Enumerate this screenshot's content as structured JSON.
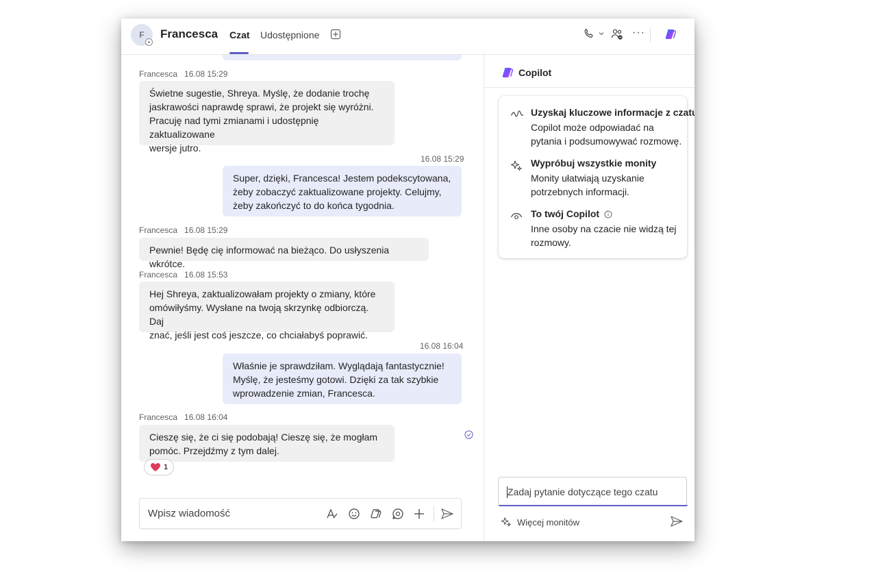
{
  "header": {
    "avatar_initial": "F",
    "contact_name": "Francesca",
    "tabs": [
      {
        "label": "Czat",
        "active": true
      },
      {
        "label": "Udostępnione",
        "active": false
      }
    ],
    "icons": [
      "call-icon",
      "chevron-down-icon",
      "people-icon",
      "more-icon",
      "copilot-icon"
    ]
  },
  "messages": [
    {
      "direction": "in",
      "sender": "Francesca",
      "time": "16.08 15:29",
      "lines": [
        "Świetne sugestie, Shreya. Myślę, że dodanie trochę",
        "jaskrawości naprawdę sprawi, że projekt się wyróżni.",
        "Pracuję nad tymi zmianami i udostępnię zaktualizowane",
        "wersje jutro."
      ]
    },
    {
      "direction": "out",
      "time": "16.08 15:29",
      "lines": [
        "Super, dzięki, Francesca! Jestem podekscytowana,",
        "żeby zobaczyć zaktualizowane projekty. Celujmy,",
        "żeby zakończyć to do końca tygodnia."
      ]
    },
    {
      "direction": "in",
      "sender": "Francesca",
      "time": "16.08 15:29",
      "lines": [
        "Pewnie! Będę cię informować na bieżąco. Do usłyszenia wkrótce."
      ]
    },
    {
      "direction": "in",
      "sender": "Francesca",
      "time": "16.08 15:53",
      "lines": [
        "Hej Shreya, zaktualizowałam projekty o zmiany, które",
        "omówiłyśmy. Wysłane na twoją skrzynkę odbiorczą. Daj",
        "znać, jeśli jest coś jeszcze, co chciałabyś poprawić."
      ]
    },
    {
      "direction": "out",
      "time": "16.08 16:04",
      "lines": [
        "Właśnie je sprawdziłam. Wyglądają fantastycznie!",
        "Myślę, że jesteśmy gotowi. Dzięki za tak szybkie",
        "wprowadzenie zmian, Francesca."
      ]
    },
    {
      "direction": "in",
      "sender": "Francesca",
      "time": "16.08 16:04",
      "lines": [
        "Cieszę się, że ci się podobają! Cieszę się, że mogłam",
        "pomóc. Przejdźmy z tym dalej."
      ],
      "reaction": {
        "emoji": "heart",
        "count": "1"
      }
    }
  ],
  "composer": {
    "placeholder": "Wpisz wiadomość",
    "icons": [
      "format-icon",
      "emoji-icon",
      "copilot-icon",
      "loop-icon",
      "attach-plus-icon",
      "send-icon"
    ]
  },
  "copilot": {
    "title": "Copilot",
    "items": [
      {
        "icon": "insights-icon",
        "title": "Uzyskaj kluczowe informacje z czatu",
        "text": "Copilot może odpowiadać na pytania i podsumowywać rozmowę."
      },
      {
        "icon": "sparkle-icon",
        "title": "Wypróbuj wszystkie monity",
        "text": "Monity ułatwiają uzyskanie potrzebnych informacji."
      },
      {
        "icon": "eye-icon",
        "title": "To twój Copilot",
        "text": "Inne osoby na czacie nie widzą tej rozmowy."
      }
    ],
    "ask_placeholder": "Zadaj pytanie dotyczące tego czatu",
    "more_prompts": "Więcej monitów"
  }
}
